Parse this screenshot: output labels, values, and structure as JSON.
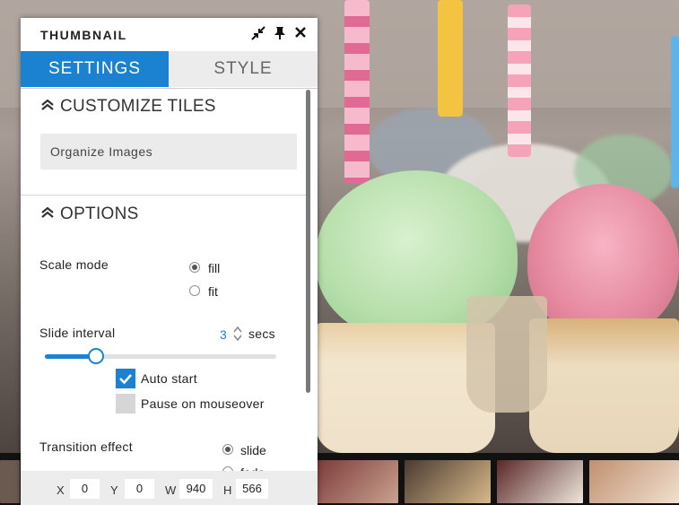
{
  "panel": {
    "title": "THUMBNAIL",
    "header_icons": [
      "collapse-icon",
      "pin-icon",
      "close-icon"
    ]
  },
  "tabs": [
    {
      "label": "SETTINGS",
      "active": true
    },
    {
      "label": "STYLE",
      "active": false
    }
  ],
  "customize_tiles": {
    "heading": "CUSTOMIZE TILES",
    "organize_button": "Organize Images"
  },
  "options": {
    "heading": "OPTIONS",
    "scale_mode": {
      "label": "Scale mode",
      "choices": [
        {
          "label": "fill",
          "selected": true
        },
        {
          "label": "fit",
          "selected": false
        }
      ]
    },
    "slide_interval": {
      "label": "Slide interval",
      "value": "3",
      "unit": "secs",
      "slider_level_percent": 22
    },
    "auto_start": {
      "label": "Auto start",
      "checked": true
    },
    "pause_on_mouseover": {
      "label": "Pause on mouseover",
      "checked": false
    },
    "transition_effect": {
      "label": "Transition effect",
      "choices": [
        {
          "label": "slide",
          "selected": true
        },
        {
          "label": "fade",
          "selected": false
        }
      ]
    }
  },
  "footer": {
    "x_label": "X",
    "x_value": "0",
    "y_label": "Y",
    "y_value": "0",
    "w_label": "W",
    "w_value": "940",
    "h_label": "H",
    "h_value": "566"
  },
  "colors": {
    "accent": "#1b82d1",
    "tab_inactive_bg": "#ececec",
    "button_bg": "#ebebeb",
    "footer_bg": "#ececec"
  }
}
